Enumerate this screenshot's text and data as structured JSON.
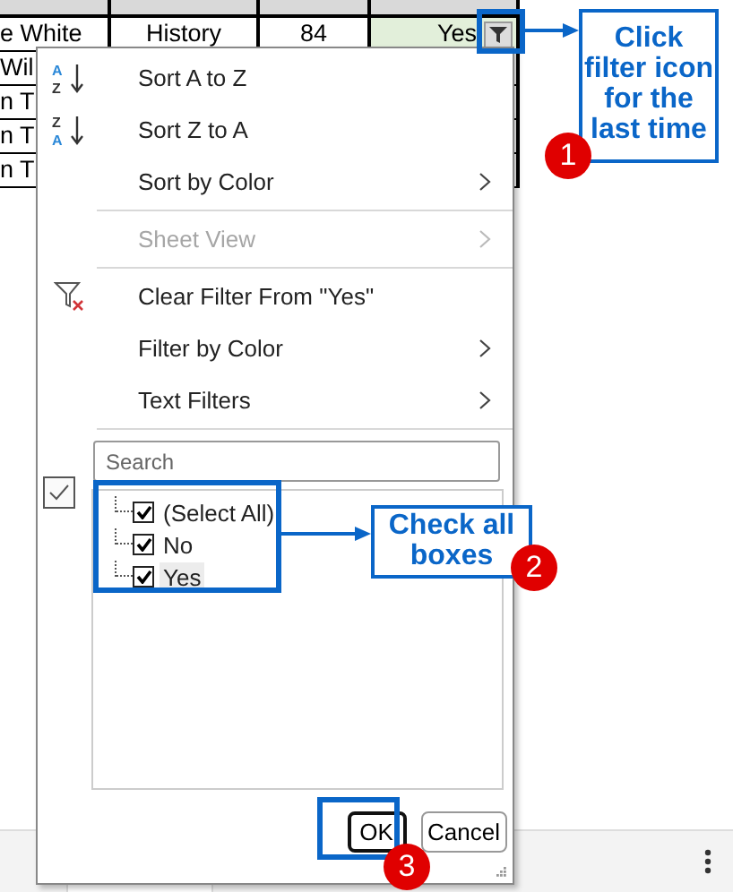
{
  "sheet": {
    "rows": [
      {
        "cells": [
          {
            "text": "e White"
          },
          {
            "text": "History"
          },
          {
            "text": "84"
          },
          {
            "text": "Yes",
            "color": "#e2efda",
            "filter_button": true
          }
        ]
      },
      {
        "cells": [
          {
            "text": "Wil"
          }
        ]
      },
      {
        "cells": [
          {
            "text": "n T"
          }
        ]
      },
      {
        "cells": [
          {
            "text": "n T"
          }
        ]
      },
      {
        "cells": [
          {
            "text": "n T"
          }
        ]
      }
    ]
  },
  "filter_menu": {
    "items": [
      {
        "kind": "sort_az",
        "icon_text": [
          "A",
          "Z"
        ],
        "label": "Sort A to Z",
        "disabled": false,
        "submenu": false
      },
      {
        "kind": "sort_za",
        "icon_text": [
          "Z",
          "A"
        ],
        "label": "Sort Z to A",
        "disabled": false,
        "submenu": false
      },
      {
        "kind": "plain",
        "label": "Sort by Color",
        "disabled": false,
        "submenu": true
      },
      {
        "kind": "separator"
      },
      {
        "kind": "plain",
        "label": "Sheet View",
        "disabled": true,
        "submenu": true
      },
      {
        "kind": "separator"
      },
      {
        "kind": "clear",
        "label": "Clear Filter From \"Yes\"",
        "disabled": false,
        "submenu": false
      },
      {
        "kind": "plain",
        "label": "Filter by Color",
        "disabled": false,
        "submenu": true
      },
      {
        "kind": "plain",
        "label": "Text Filters",
        "disabled": false,
        "submenu": true
      },
      {
        "kind": "separator"
      }
    ],
    "search": {
      "placeholder": "Search"
    },
    "side_checkbox": {
      "checked": true
    },
    "values": [
      {
        "label": "(Select All)",
        "checked": true,
        "selected": false
      },
      {
        "label": "No",
        "checked": true,
        "selected": false
      },
      {
        "label": "Yes",
        "checked": true,
        "selected": true
      }
    ],
    "buttons": [
      {
        "label": "OK",
        "default": true
      },
      {
        "label": "Cancel",
        "default": false
      }
    ]
  },
  "annotations": [
    {
      "text": "Click filter icon for the last time",
      "badge": "1"
    },
    {
      "text": "Check all boxes",
      "badge": "2"
    },
    {
      "badge": "3"
    }
  ]
}
